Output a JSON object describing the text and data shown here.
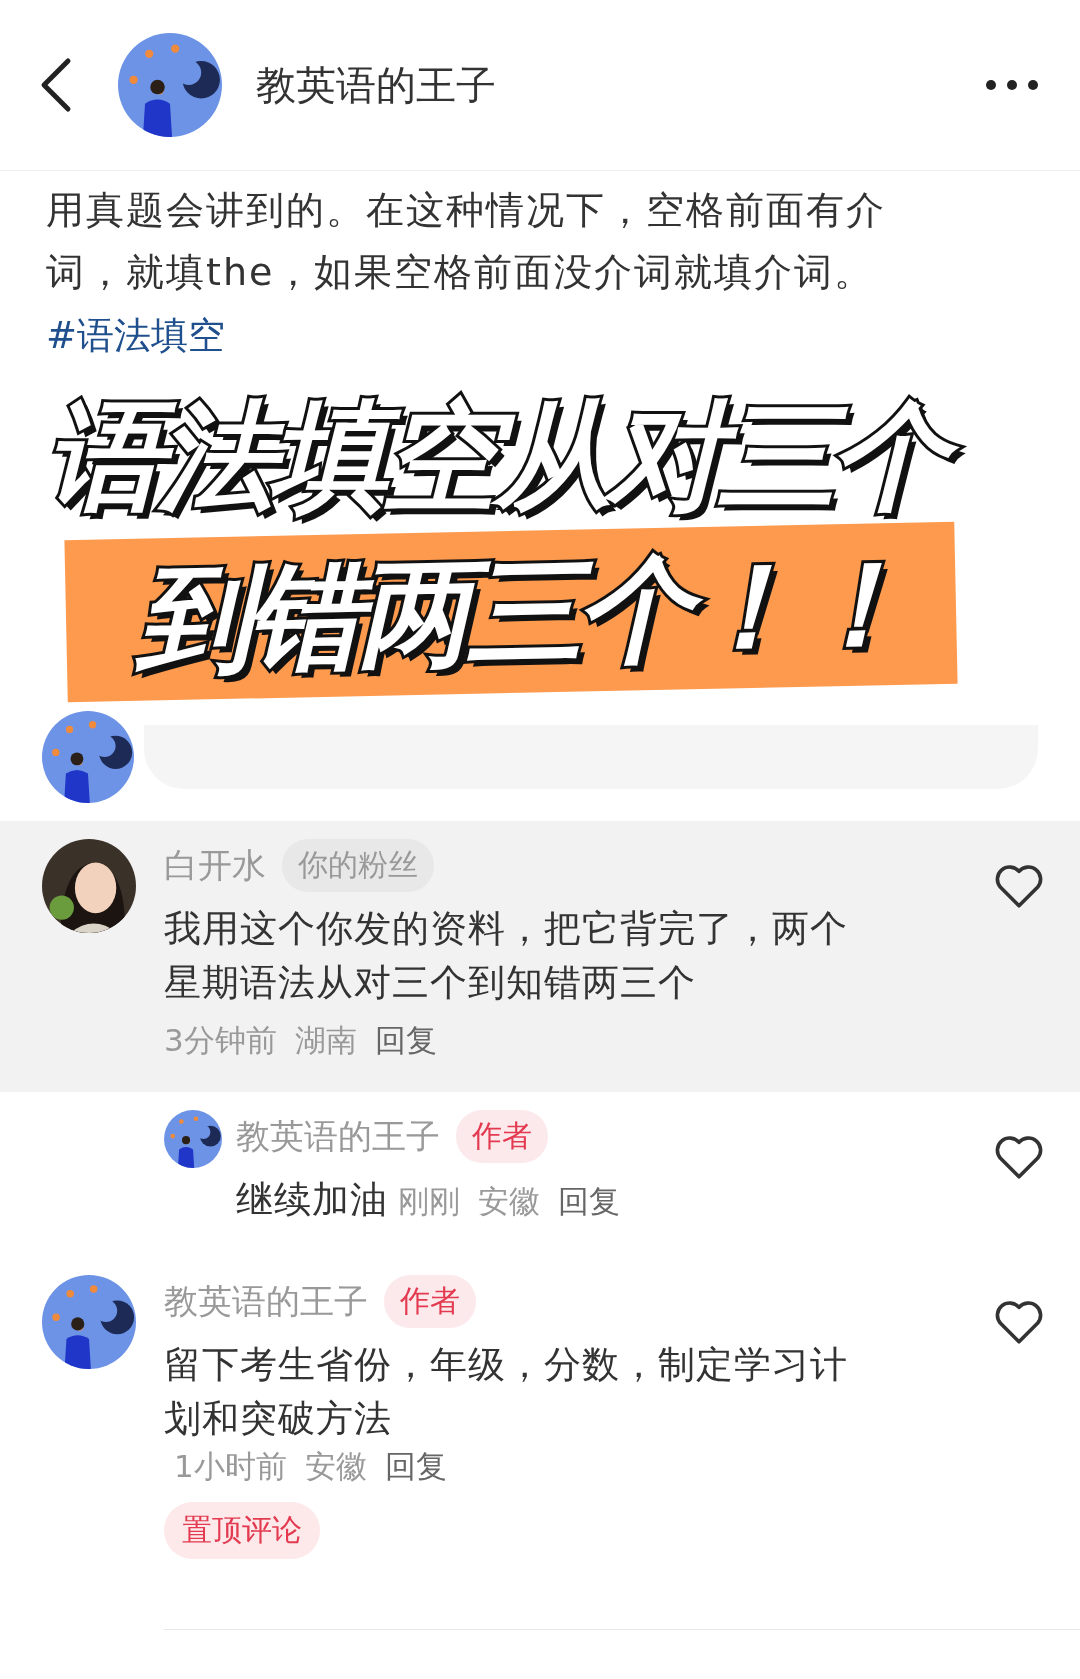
{
  "header": {
    "author": "教英语的王子"
  },
  "post": {
    "body": "用真题会讲到的。在这种情况下，空格前面有介词，就填the，如果空格前面没介词就填介词。",
    "hashtag": "#语法填空"
  },
  "caption": {
    "line_1": "语法填空从对三个",
    "line_2": "到错两三个！！"
  },
  "comments": [
    {
      "kind": "comment",
      "highlighted": true,
      "name": "白开水",
      "badge": {
        "label": "你的粉丝",
        "color": "#999999"
      },
      "text": "我用这个你发的资料，把它背完了，两个星期语法从对三个到知错两三个",
      "time": "3分钟前",
      "region": "湖南",
      "reply": "回复"
    },
    {
      "kind": "reply",
      "highlighted": false,
      "name": "教英语的王子",
      "badge": {
        "label": "作者",
        "color": "#e33a50"
      },
      "text": "继续加油",
      "time": "刚刚",
      "region": "安徽",
      "reply": "回复"
    },
    {
      "kind": "comment",
      "highlighted": false,
      "name": "教英语的王子",
      "badge": {
        "label": "作者",
        "color": "#e33a50"
      },
      "text": "留下考生省份，年级，分数，制定学习计划和突破方法",
      "time": "1小时前",
      "region": "安徽",
      "reply": "回复",
      "pin": "置顶评论"
    }
  ]
}
